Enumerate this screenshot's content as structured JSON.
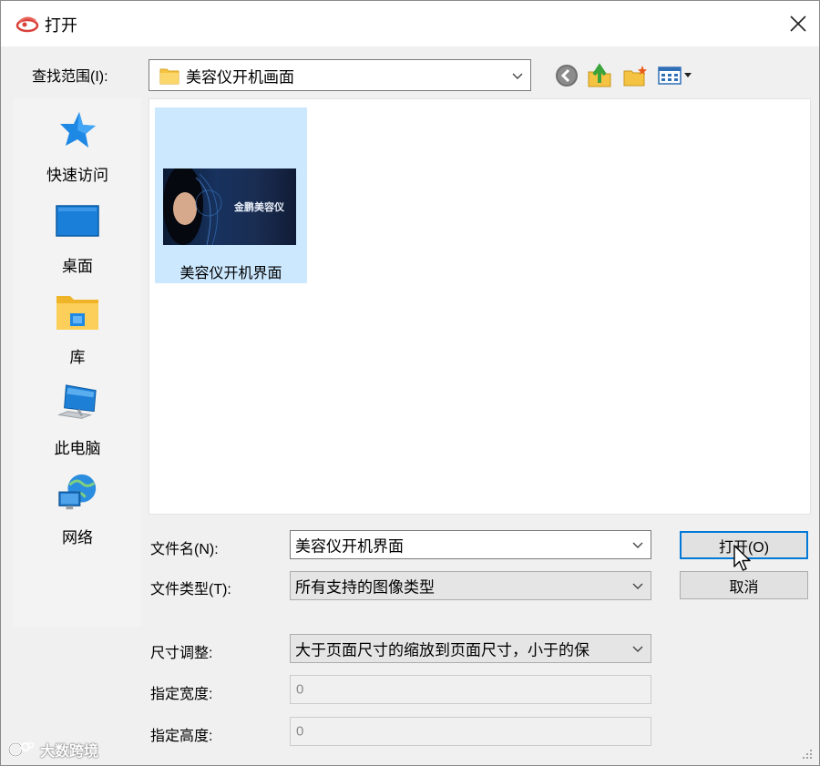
{
  "window": {
    "title": "打开"
  },
  "lookin": {
    "label": "查找范围(I):",
    "value": "美容仪开机画面"
  },
  "toolbar": {
    "back_icon": "back-arrow-icon",
    "up_icon": "up-folder-icon",
    "new_folder_icon": "new-folder-icon",
    "view_icon": "view-menu-icon"
  },
  "sidebar": {
    "items": [
      {
        "label": "快速访问",
        "icon": "star-icon"
      },
      {
        "label": "桌面",
        "icon": "desktop-icon"
      },
      {
        "label": "库",
        "icon": "library-folder-icon"
      },
      {
        "label": "此电脑",
        "icon": "computer-icon"
      },
      {
        "label": "网络",
        "icon": "network-icon"
      }
    ]
  },
  "files": [
    {
      "name": "美容仪开机界面",
      "thumb_text": "金鹏美容仪",
      "selected": true
    }
  ],
  "form": {
    "filename": {
      "label": "文件名(N):",
      "value": "美容仪开机界面"
    },
    "filetype": {
      "label": "文件类型(T):",
      "value": "所有支持的图像类型"
    },
    "resize": {
      "label": "尺寸调整:",
      "value": "大于页面尺寸的缩放到页面尺寸，小于的保"
    },
    "width": {
      "label": "指定宽度:",
      "value": "0"
    },
    "height": {
      "label": "指定高度:",
      "value": "0"
    }
  },
  "buttons": {
    "open": "打开(O)",
    "cancel": "取消"
  },
  "watermark": "大数跨境",
  "colors": {
    "selection": "#cce8ff",
    "focus_border": "#0078d7",
    "dialog_bg": "#f0f0f0",
    "icon_blue": "#1e88e5",
    "folder_yellow": "#f5c342"
  }
}
